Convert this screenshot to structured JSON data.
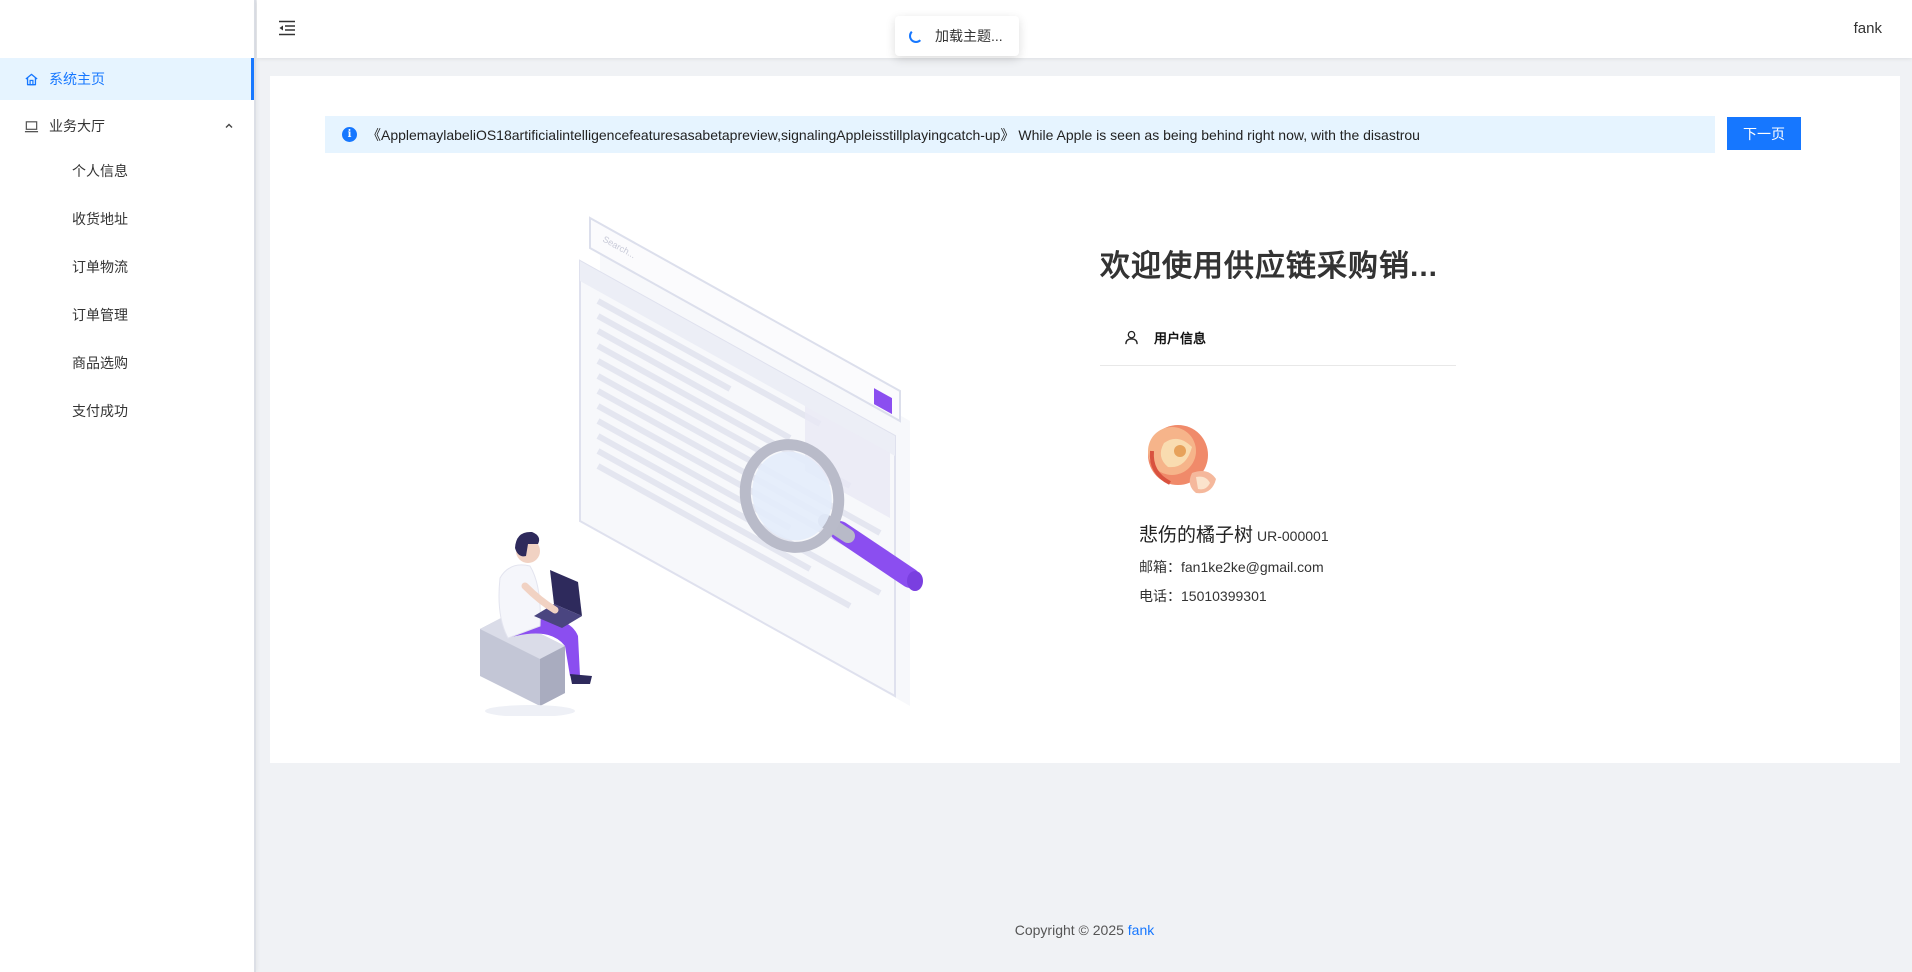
{
  "sidebar": {
    "items": [
      {
        "label": "系统主页",
        "icon": "home-icon",
        "active": true
      },
      {
        "label": "业务大厅",
        "icon": "laptop-icon",
        "expanded": true
      }
    ],
    "subitems": [
      {
        "label": "个人信息"
      },
      {
        "label": "收货地址"
      },
      {
        "label": "订单物流"
      },
      {
        "label": "订单管理"
      },
      {
        "label": "商品选购"
      },
      {
        "label": "支付成功"
      }
    ]
  },
  "header": {
    "username": "fank",
    "toast": "加载主题..."
  },
  "notice": {
    "text": "《ApplemaylabeliOS18artificialintelligencefeaturesasabetapreview,signalingAppleisstillplayingcatch-up》 While Apple is seen as being behind right now, with the disastrou",
    "button": "下一页"
  },
  "illustration": {
    "search_placeholder": "Search..."
  },
  "welcome": {
    "title": "欢迎使用供应链采购销...",
    "tab_label": "用户信息"
  },
  "profile": {
    "name": "悲伤的橘子树",
    "id": "UR-000001",
    "email_line": "邮箱：fan1ke2ke@gmail.com",
    "phone_line": "电话：15010399301"
  },
  "footer": {
    "copyright": "Copyright © 2025",
    "author": "fank"
  },
  "colors": {
    "primary": "#1677ff",
    "active_bg": "#e6f4ff",
    "illustration_accent": "#8b4ef0"
  }
}
